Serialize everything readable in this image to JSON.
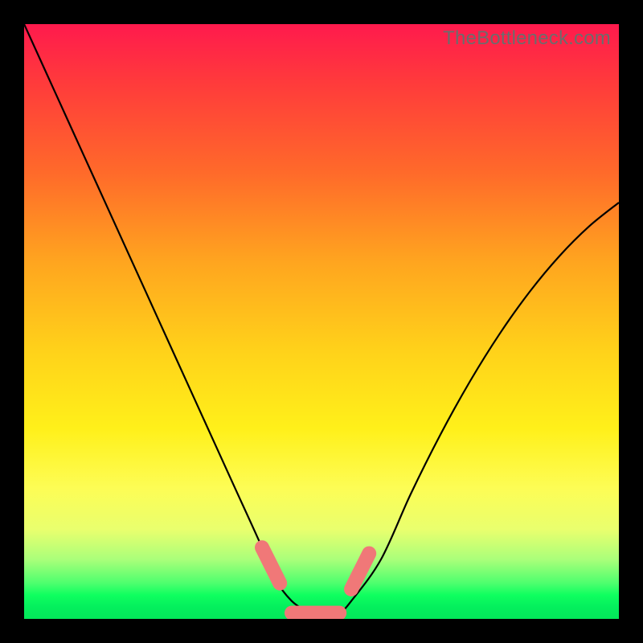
{
  "watermark": "TheBottleneck.com",
  "colors": {
    "backdrop": "#000000",
    "curve": "#000000",
    "highlight": "#f07878",
    "gradient_top": "#ff1a4d",
    "gradient_bottom": "#03e85a"
  },
  "chart_data": {
    "type": "line",
    "title": "",
    "xlabel": "",
    "ylabel": "",
    "xlim": [
      0,
      100
    ],
    "ylim": [
      0,
      100
    ],
    "grid": false,
    "legend": false,
    "series": [
      {
        "name": "bottleneck-curve",
        "x": [
          0,
          5,
          10,
          15,
          20,
          25,
          30,
          35,
          40,
          42,
          45,
          48,
          50,
          53,
          55,
          60,
          65,
          70,
          75,
          80,
          85,
          90,
          95,
          100
        ],
        "y": [
          100,
          89,
          78,
          67,
          56,
          45,
          34,
          23,
          12,
          7,
          3,
          1,
          0,
          1,
          3,
          10,
          21,
          31,
          40,
          48,
          55,
          61,
          66,
          70
        ]
      }
    ],
    "highlights": [
      {
        "name": "left-dash",
        "x": [
          40,
          43
        ],
        "y": [
          12,
          6
        ]
      },
      {
        "name": "floor-dash",
        "x": [
          45,
          53
        ],
        "y": [
          1,
          1
        ]
      },
      {
        "name": "right-dash",
        "x": [
          55,
          58
        ],
        "y": [
          5,
          11
        ]
      }
    ]
  }
}
